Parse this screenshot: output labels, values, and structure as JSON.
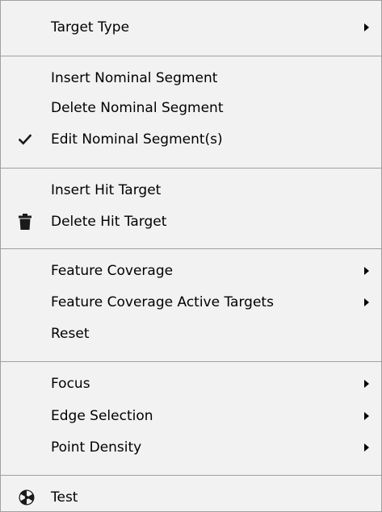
{
  "menu": {
    "items": {
      "target_type": {
        "label": "Target Type",
        "icon": "chevron-right-icon"
      },
      "insert_nominal_segment": {
        "label": "Insert Nominal Segment"
      },
      "delete_nominal_segment": {
        "label": "Delete Nominal Segment"
      },
      "edit_nominal_segments": {
        "label": "Edit Nominal Segment(s)",
        "icon": "checkmark-icon",
        "checked": true
      },
      "insert_hit_target": {
        "label": "Insert Hit Target"
      },
      "delete_hit_target": {
        "label": "Delete Hit Target",
        "icon": "trash-icon"
      },
      "feature_coverage": {
        "label": "Feature Coverage",
        "icon": "chevron-right-icon"
      },
      "feature_coverage_active_targets": {
        "label": "Feature Coverage Active Targets",
        "icon": "chevron-right-icon"
      },
      "reset": {
        "label": "Reset"
      },
      "focus": {
        "label": "Focus",
        "icon": "chevron-right-icon"
      },
      "edge_selection": {
        "label": "Edge Selection",
        "icon": "chevron-right-icon"
      },
      "point_density": {
        "label": "Point Density",
        "icon": "chevron-right-icon"
      },
      "test": {
        "label": "Test",
        "icon": "radiation-icon"
      }
    }
  },
  "colors": {
    "menu_background": "#f2f2f2",
    "separator": "#a0a0a0",
    "text": "#000000",
    "icon": "#1a1a1a"
  }
}
